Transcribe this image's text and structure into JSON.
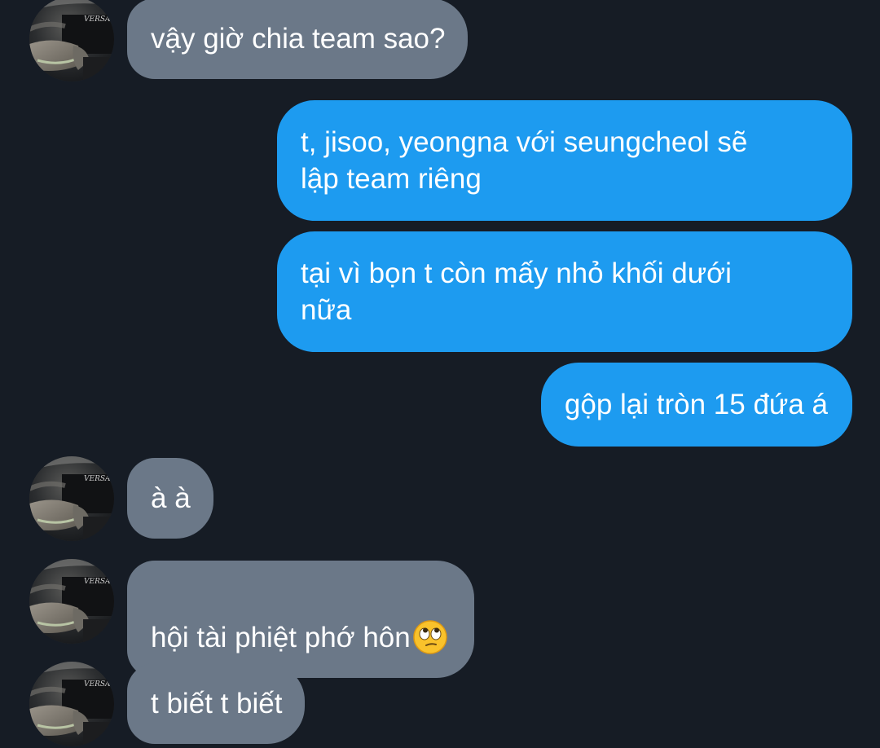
{
  "conversation": {
    "messages": [
      {
        "direction": "incoming",
        "text": "vậy giờ chia team sao?"
      },
      {
        "direction": "outgoing",
        "text": "t, jisoo, yeongna với seungcheol sẽ\nlập team riêng"
      },
      {
        "direction": "outgoing",
        "text": "tại vì bọn t còn mấy nhỏ khối dưới\nnữa"
      },
      {
        "direction": "outgoing",
        "text": "gộp lại tròn 15 đứa á"
      },
      {
        "direction": "incoming",
        "text": "à à"
      },
      {
        "direction": "incoming",
        "text": "hội tài phiệt phớ hôn",
        "emoji": "face-with-rolling-eyes"
      },
      {
        "direction": "incoming",
        "text": "t biết t biết"
      }
    ]
  },
  "avatar": {
    "watermark": "VERSACE"
  },
  "colors": {
    "background": "#161c25",
    "incoming_bubble": "#6b7888",
    "outgoing_bubble": "#1d9bf0",
    "text": "#ffffff"
  }
}
